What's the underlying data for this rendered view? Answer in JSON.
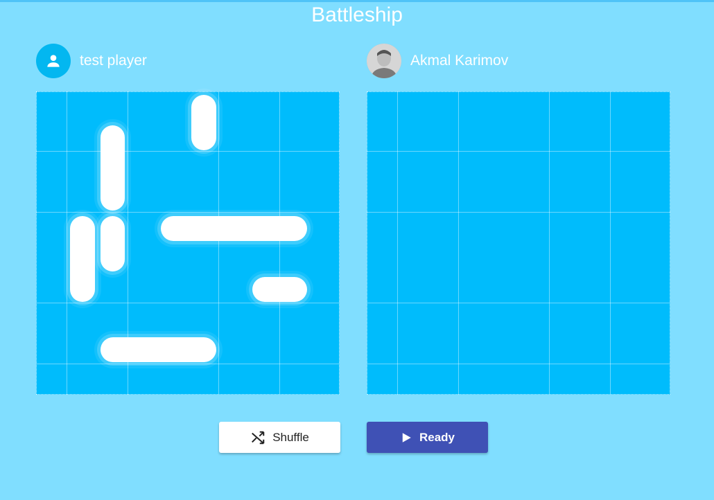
{
  "app": {
    "title": "Battleship"
  },
  "players": {
    "left": {
      "name": "test player",
      "avatar_icon": "person-icon"
    },
    "right": {
      "name": "Akmal Karimov",
      "avatar_icon": "user-photo"
    }
  },
  "board": {
    "rows": 10,
    "cols": 10
  },
  "ships": [
    {
      "orientation": "vertical",
      "length": 2,
      "row": 1,
      "col": 6
    },
    {
      "orientation": "vertical",
      "length": 3,
      "row": 2,
      "col": 3
    },
    {
      "orientation": "vertical",
      "length": 2,
      "row": 5,
      "col": 3
    },
    {
      "orientation": "vertical",
      "length": 3,
      "row": 5,
      "col": 2
    },
    {
      "orientation": "horizontal",
      "length": 5,
      "row": 5,
      "col": 5
    },
    {
      "orientation": "horizontal",
      "length": 2,
      "row": 7,
      "col": 8
    },
    {
      "orientation": "horizontal",
      "length": 4,
      "row": 9,
      "col": 3
    }
  ],
  "buttons": {
    "shuffle": {
      "label": "Shuffle",
      "icon": "shuffle-icon"
    },
    "ready": {
      "label": "Ready",
      "icon": "play-icon"
    }
  },
  "colors": {
    "background": "#80deff",
    "board": "#00bcfc",
    "ship": "#ffffff",
    "ready_button": "#3f51b5",
    "avatar": "#03b7f0"
  }
}
